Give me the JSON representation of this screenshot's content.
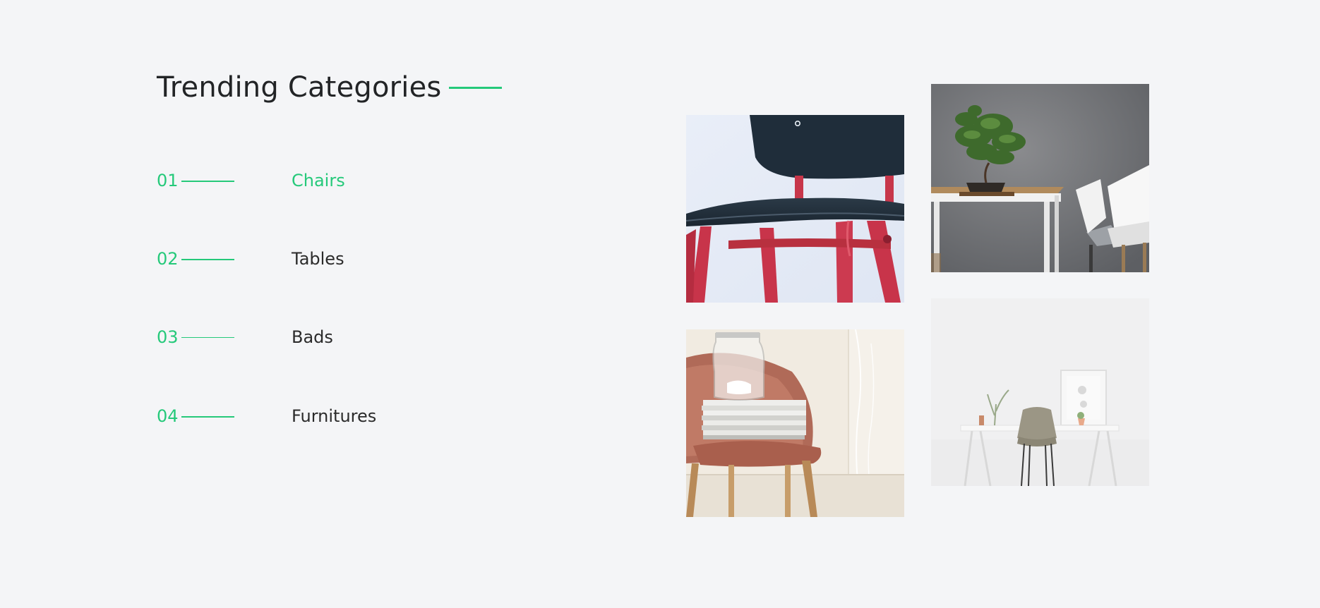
{
  "section": {
    "title": "Trending Categories"
  },
  "categories": [
    {
      "number": "01",
      "label": "Chairs",
      "active": true
    },
    {
      "number": "02",
      "label": "Tables",
      "active": false
    },
    {
      "number": "03",
      "label": "Bads",
      "active": false
    },
    {
      "number": "04",
      "label": "Furnitures",
      "active": false
    }
  ],
  "gallery": [
    {
      "name": "red-chair-photo",
      "alt": "Black chair with red legs"
    },
    {
      "name": "table-bonsai-photo",
      "alt": "Wooden table with bonsai and white chair"
    },
    {
      "name": "pink-chair-photo",
      "alt": "Pink velvet chair with books and glass vase"
    },
    {
      "name": "white-desk-photo",
      "alt": "White desk with grey chair"
    }
  ],
  "colors": {
    "accent": "#25c97a",
    "background": "#f4f5f7",
    "text": "#2b2b2b"
  }
}
